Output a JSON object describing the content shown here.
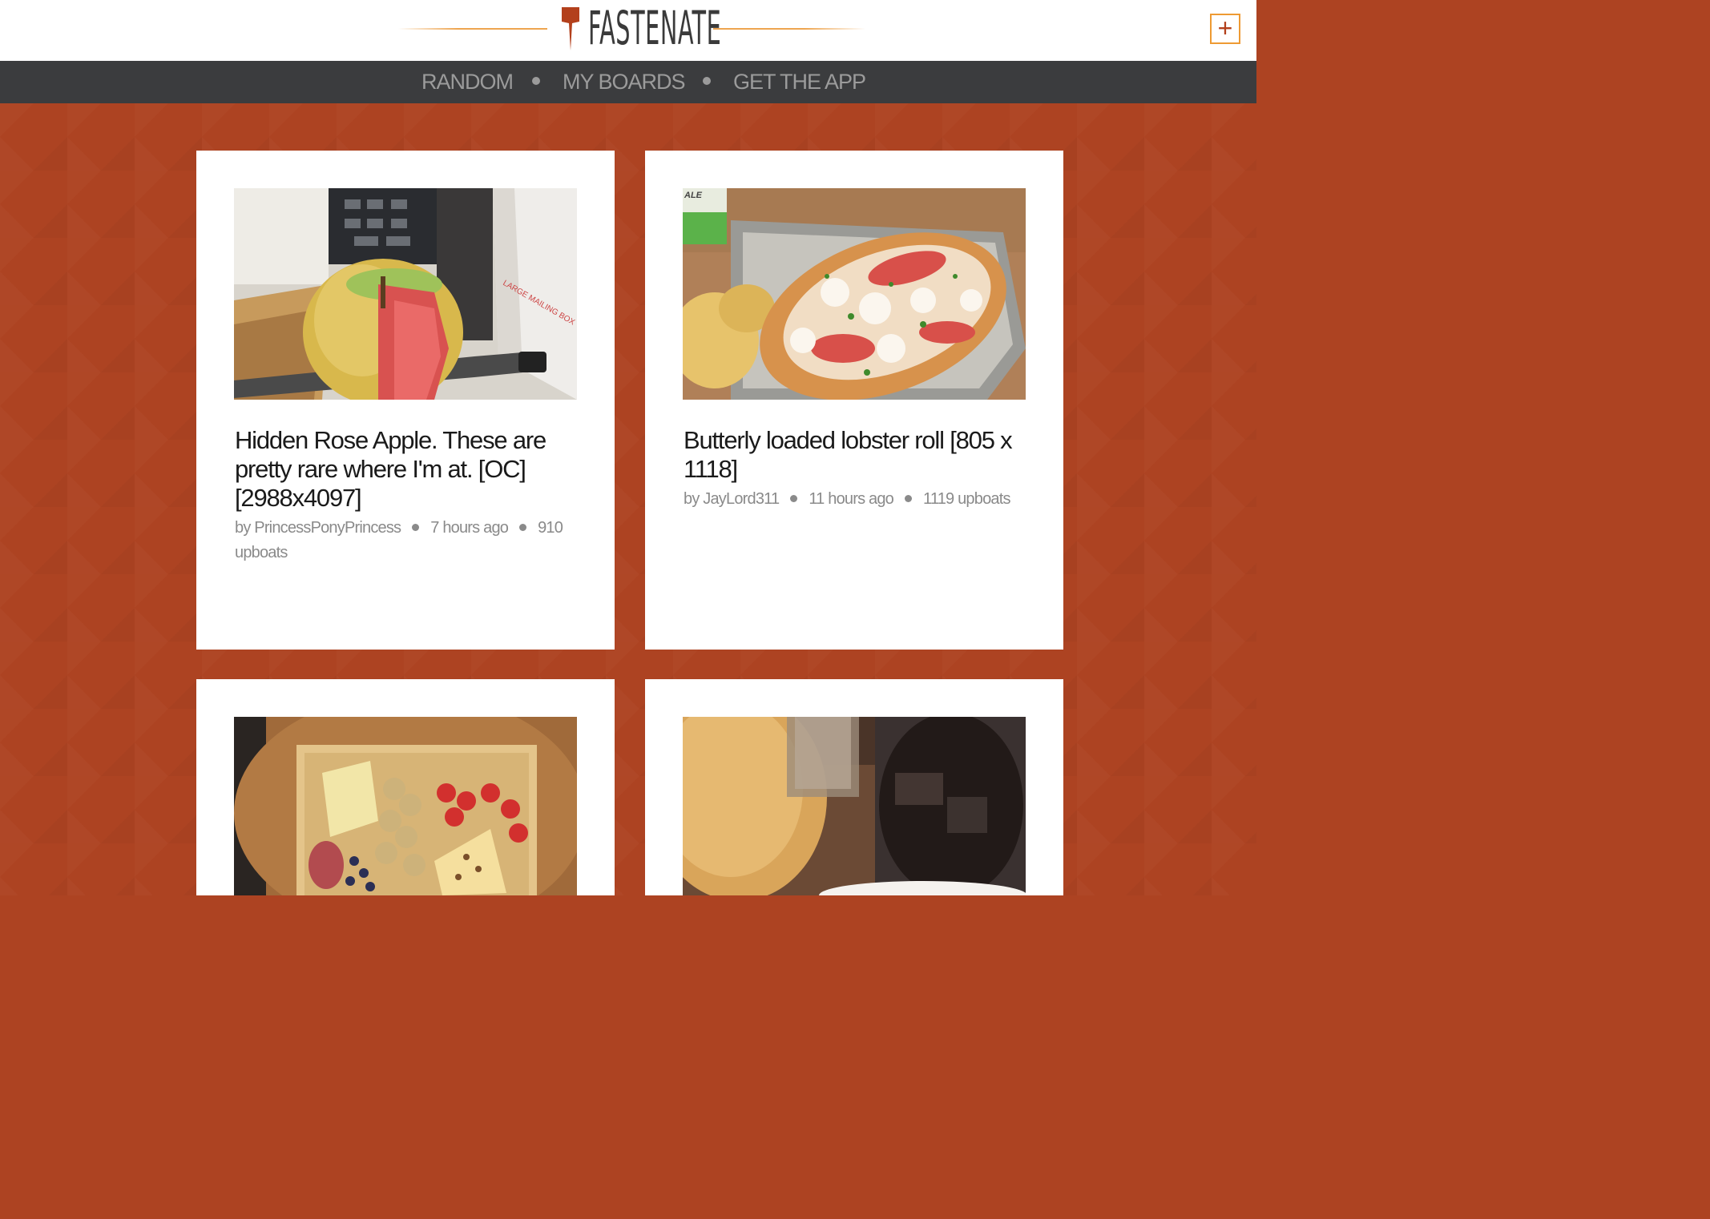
{
  "brand": {
    "name": "FASTENATE",
    "accent_color": "#ad4322",
    "rule_color": "#eea550"
  },
  "header": {
    "add_label": "+"
  },
  "nav": {
    "items": [
      {
        "label": "RANDOM"
      },
      {
        "label": "MY BOARDS"
      },
      {
        "label": "GET THE APP"
      }
    ]
  },
  "posts": [
    {
      "title": "Hidden Rose Apple. These are pretty rare where I'm at. [OC] [2988x4097]",
      "author": "by PrincessPonyPrincess",
      "time": "7 hours ago",
      "upboats": "910 upboats",
      "image": "apple-photo"
    },
    {
      "title": "Butterly loaded lobster roll [805 x 1118]",
      "author": "by JayLord311",
      "time": "11 hours ago",
      "upboats": "1119 upboats",
      "image": "lobster-roll-photo"
    },
    {
      "title": "",
      "author": "",
      "time": "",
      "upboats": "",
      "image": "charcuterie-board-photo"
    },
    {
      "title": "",
      "author": "",
      "time": "",
      "upboats": "",
      "image": "drinks-photo"
    }
  ]
}
